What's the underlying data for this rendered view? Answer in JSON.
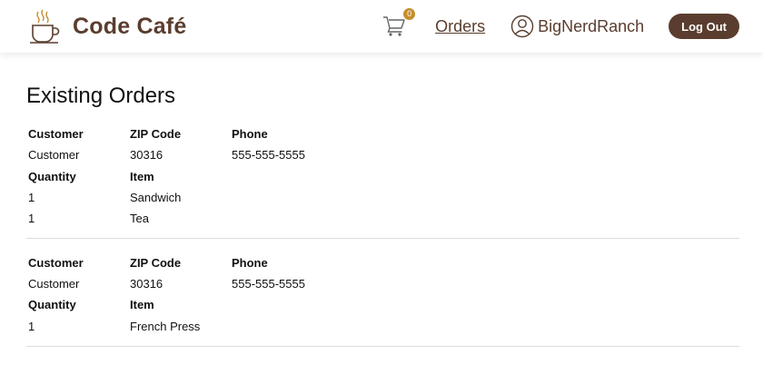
{
  "header": {
    "brand_title": "Code Café",
    "cart_count": "0",
    "orders_label": "Orders",
    "username": "BigNerdRanch",
    "logout_label": "Log Out"
  },
  "main": {
    "title": "Existing Orders",
    "orders": [
      {
        "customer_header": "Customer",
        "zip_header": "ZIP Code",
        "phone_header": "Phone",
        "customer": "Customer",
        "zip": "30316",
        "phone": "555-555-5555",
        "quantity_header": "Quantity",
        "item_header": "Item",
        "items": [
          {
            "quantity": "1",
            "item": "Sandwich"
          },
          {
            "quantity": "1",
            "item": "Tea"
          }
        ]
      },
      {
        "customer_header": "Customer",
        "zip_header": "ZIP Code",
        "phone_header": "Phone",
        "customer": "Customer",
        "zip": "30316",
        "phone": "555-555-5555",
        "quantity_header": "Quantity",
        "item_header": "Item",
        "items": [
          {
            "quantity": "1",
            "item": "French Press"
          }
        ]
      }
    ]
  },
  "colors": {
    "brand": "#5a3d2e",
    "badge": "#c58f2e",
    "divider": "#dcdcdc"
  },
  "icons": {
    "logo": "coffee-cup-icon",
    "cart": "shopping-cart-icon",
    "user": "user-circle-icon"
  }
}
